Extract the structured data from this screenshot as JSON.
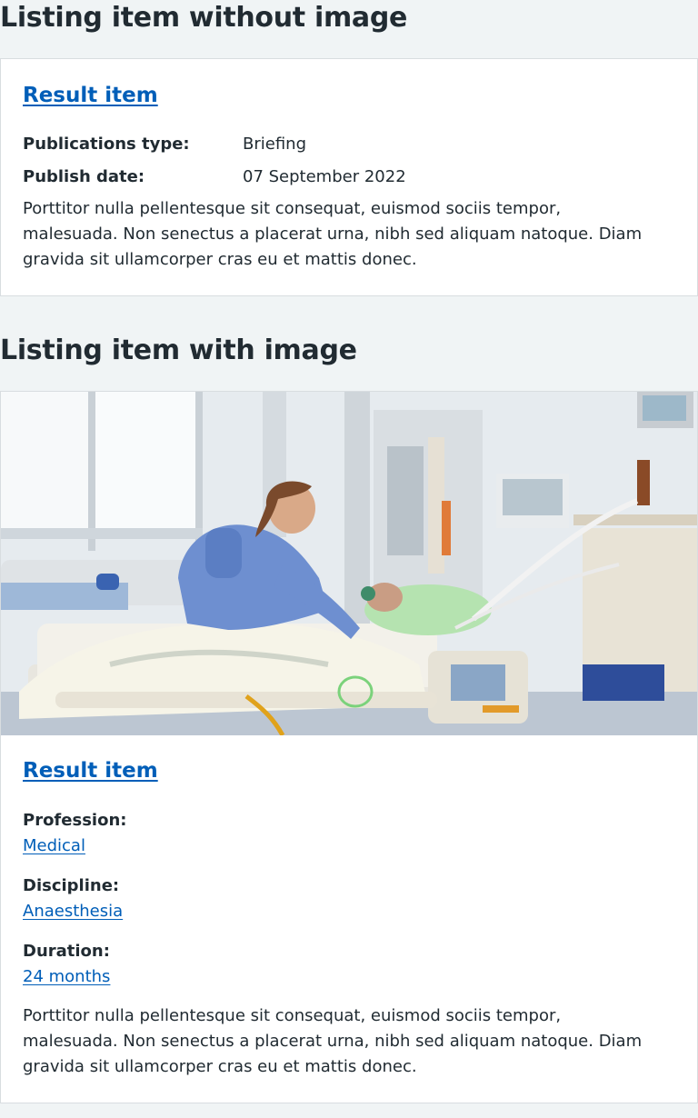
{
  "section_without_image": {
    "heading": "Listing item without image",
    "item": {
      "title": "Result item",
      "publications_type_label": "Publications type:",
      "publications_type_value": "Briefing",
      "publish_date_label": "Publish date:",
      "publish_date_value": "07 September 2022",
      "description": "Porttitor nulla pellentesque sit consequat, euismod sociis tempor, malesuada. Non senectus a placerat urna, nibh sed aliquam natoque. Diam gravida sit ullamcorper cras eu et mattis donec."
    }
  },
  "section_with_image": {
    "heading": "Listing item with image",
    "item": {
      "title": "Result item",
      "profession_label": "Profession:",
      "profession_value": "Medical",
      "discipline_label": "Discipline:",
      "discipline_value": "Anaesthesia",
      "duration_label": "Duration:",
      "duration_value": "24 months",
      "description": "Porttitor nulla pellentesque sit consequat, euismod sociis tempor, malesuada. Non senectus a placerat urna, nibh sed aliquam natoque. Diam gravida sit ullamcorper cras eu et mattis donec."
    }
  },
  "colors": {
    "page_background": "#f0f4f5",
    "text": "#212b32",
    "link": "#005eb8",
    "card_border": "#d8dde0"
  }
}
